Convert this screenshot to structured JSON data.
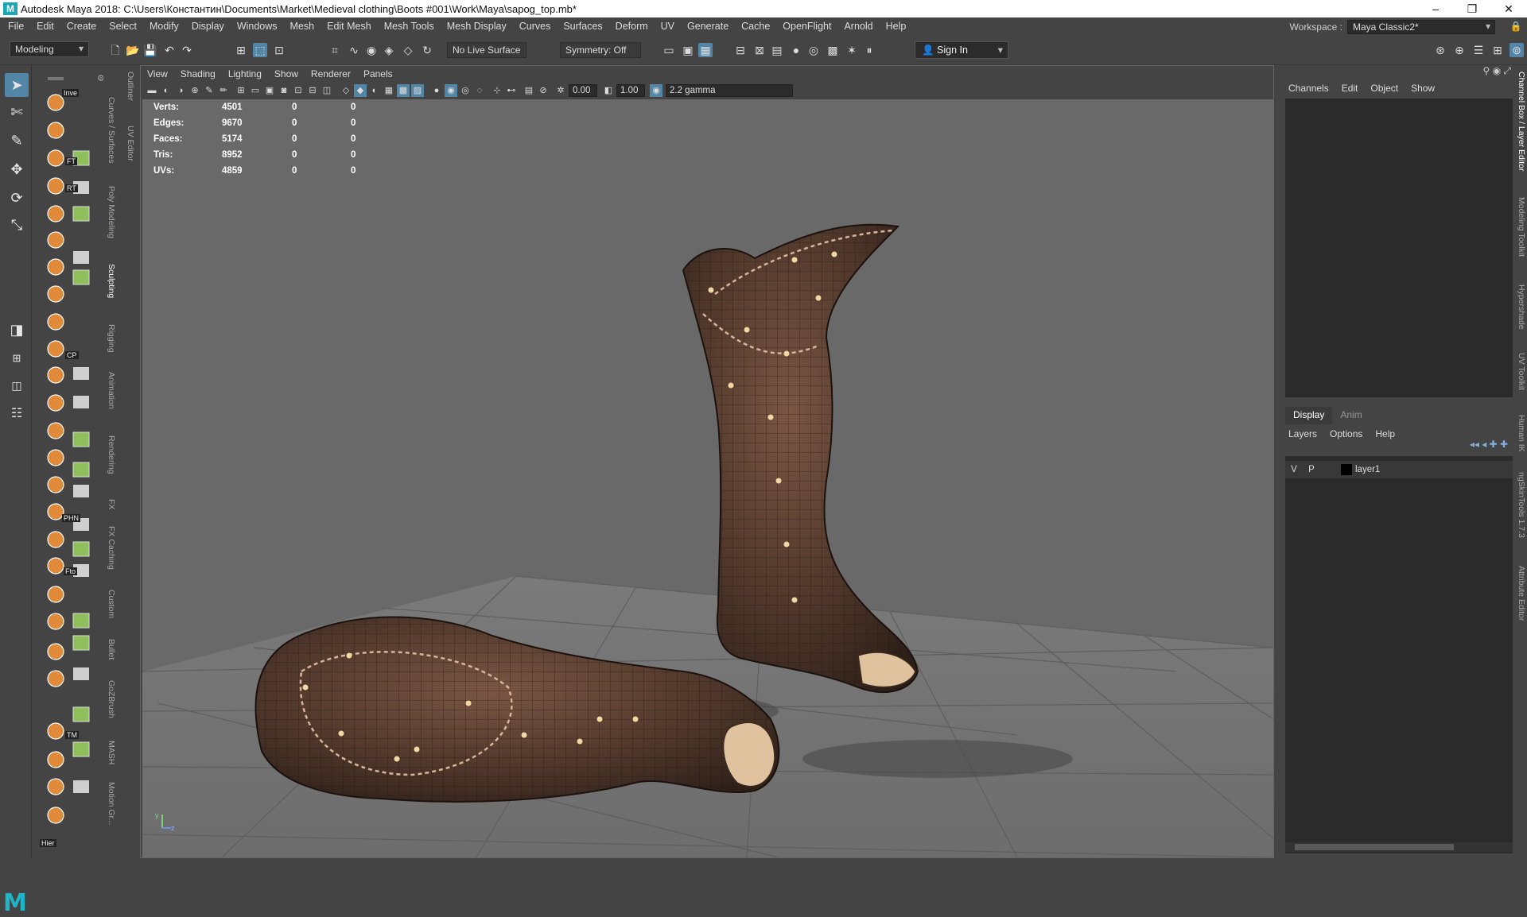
{
  "window": {
    "title": "Autodesk Maya 2018: C:\\Users\\Константин\\Documents\\Market\\Medieval clothing\\Boots #001\\Work\\Maya\\sapog_top.mb*",
    "minimize": "–",
    "maximize": "❐",
    "close": "✕"
  },
  "menubar": [
    "File",
    "Edit",
    "Create",
    "Select",
    "Modify",
    "Display",
    "Windows",
    "Mesh",
    "Edit Mesh",
    "Mesh Tools",
    "Mesh Display",
    "Curves",
    "Surfaces",
    "Deform",
    "UV",
    "Generate",
    "Cache",
    "OpenFlight",
    "Arnold",
    "Help"
  ],
  "workspace": {
    "label": "Workspace :",
    "value": "Maya Classic2*"
  },
  "statusline": {
    "mode": "Modeling",
    "live_surface": "No Live Surface",
    "symmetry": "Symmetry: Off",
    "sign_in": "Sign In"
  },
  "shelf_tabs": [
    "Curves / Surfaces",
    "Poly Modeling",
    "Sculpting",
    "Rigging",
    "Animation",
    "Rendering",
    "FX",
    "FX Caching",
    "Custom",
    "Bullet",
    "GoZBrush",
    "MASH",
    "Motion Gr..."
  ],
  "shelf_active": "Sculpting",
  "outliner_tabs": [
    "Outliner",
    "UV Editor"
  ],
  "shelf_labels": {
    "inve": "Inve",
    "ft": "FT",
    "rt": "RT",
    "cp": "CP",
    "phn": "PHN",
    "fto": "Fto",
    "tm": "TM",
    "hier": "Hier"
  },
  "viewport": {
    "menu": [
      "View",
      "Shading",
      "Lighting",
      "Show",
      "Renderer",
      "Panels"
    ],
    "exposure": "0.00",
    "gamma": "1.00",
    "color_space": "2.2 gamma",
    "hud": [
      {
        "label": "Verts:",
        "v1": "4501",
        "v2": "0",
        "v3": "0"
      },
      {
        "label": "Edges:",
        "v1": "9670",
        "v2": "0",
        "v3": "0"
      },
      {
        "label": "Faces:",
        "v1": "5174",
        "v2": "0",
        "v3": "0"
      },
      {
        "label": "Tris:",
        "v1": "8952",
        "v2": "0",
        "v3": "0"
      },
      {
        "label": "UVs:",
        "v1": "4859",
        "v2": "0",
        "v3": "0"
      }
    ],
    "axis_y": "y",
    "axis_z": "z"
  },
  "channel_box": {
    "menu": [
      "Channels",
      "Edit",
      "Object",
      "Show"
    ]
  },
  "layer_editor": {
    "tabs": [
      "Display",
      "Anim"
    ],
    "menu": [
      "Layers",
      "Options",
      "Help"
    ],
    "layer": {
      "v": "V",
      "p": "P",
      "name": "layer1"
    }
  },
  "right_tabs": [
    "Channel Box / Layer Editor",
    "Modeling Toolkit",
    "Hypershade",
    "UV Toolkit",
    "Human IK",
    "ngSkinTools 1.7.3",
    "Attribute Editor"
  ],
  "colors": {
    "accent": "#5285a6",
    "viewport_bg": "#696969",
    "panel_bg": "#444444",
    "field_bg": "#2b2b2b"
  }
}
